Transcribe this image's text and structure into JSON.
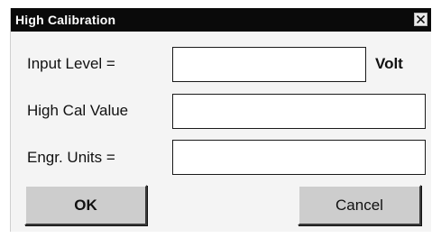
{
  "dialog": {
    "title": "High Calibration",
    "close_icon": "close-icon"
  },
  "fields": {
    "input_level": {
      "label": "Input Level =",
      "value": "",
      "unit": "Volt"
    },
    "high_cal_value": {
      "label": "High Cal Value",
      "value": ""
    },
    "engr_units": {
      "label": "Engr. Units =",
      "value": ""
    }
  },
  "buttons": {
    "ok_label": "OK",
    "cancel_label": "Cancel"
  }
}
